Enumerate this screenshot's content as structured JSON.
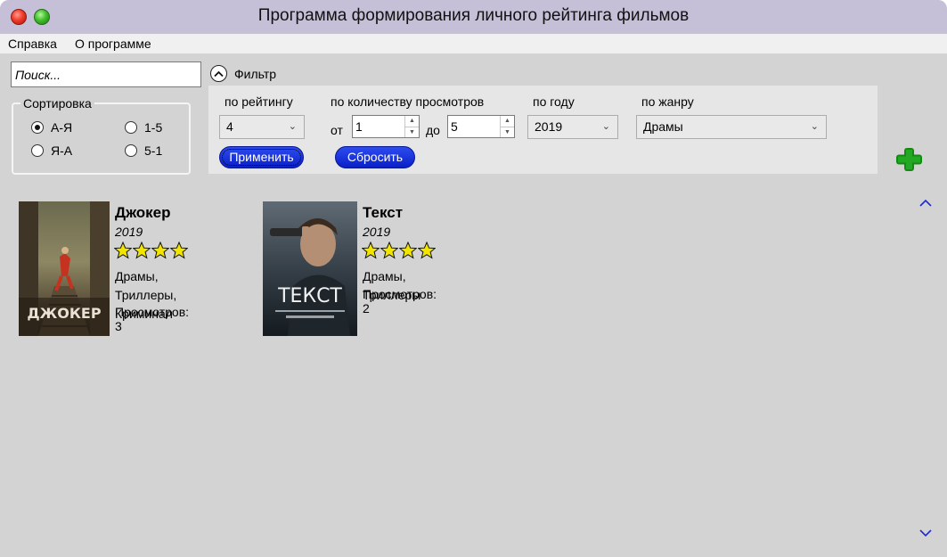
{
  "window": {
    "title": "Программа формирования личного рейтинга фильмов",
    "close_icon": "close-traffic-light",
    "maximize_icon": "maximize-traffic-light"
  },
  "menu": {
    "help": "Справка",
    "about": "О программе"
  },
  "search": {
    "placeholder": "Поиск...",
    "value": ""
  },
  "sort": {
    "legend": "Сортировка",
    "options": [
      {
        "label": "А-Я",
        "checked": true
      },
      {
        "label": "Я-А",
        "checked": false
      },
      {
        "label": "1-5",
        "checked": false
      },
      {
        "label": "5-1",
        "checked": false
      }
    ]
  },
  "filter": {
    "label": "Фильтр",
    "toggle_icon": "chevron-up-icon",
    "by_rating_label": "по рейтингу",
    "rating_value": "4",
    "by_views_label": "по количеству просмотров",
    "from_label": "от",
    "from_value": "1",
    "to_label": "до",
    "to_value": "5",
    "by_year_label": "по году",
    "year_value": "2019",
    "by_genre_label": "по жанру",
    "genre_value": "Драмы",
    "apply_label": "Применить",
    "reset_label": "Сбросить"
  },
  "add_button": {
    "icon": "plus-icon",
    "color": "#1a8a1a"
  },
  "movies": [
    {
      "title": "Джокер",
      "year": "2019",
      "rating": 4,
      "genres_line1": "Драмы, Триллеры,",
      "genres_line2": "Криминал",
      "views": "Просмотров: 3",
      "poster_text": "ДЖОКЕР"
    },
    {
      "title": "Текст",
      "year": "2019",
      "rating": 4,
      "genres_line1": "Драмы, Триллеры",
      "views": "Просмотров: 2",
      "poster_text": "ТЕКСТ"
    }
  ],
  "scroll": {
    "up_icon": "chevron-up-icon",
    "down_icon": "chevron-down-icon"
  },
  "colors": {
    "titlebar": "#c6bfd8",
    "background": "#d3d3d3",
    "button": "#0a1fc8",
    "star": "#f2e600"
  }
}
